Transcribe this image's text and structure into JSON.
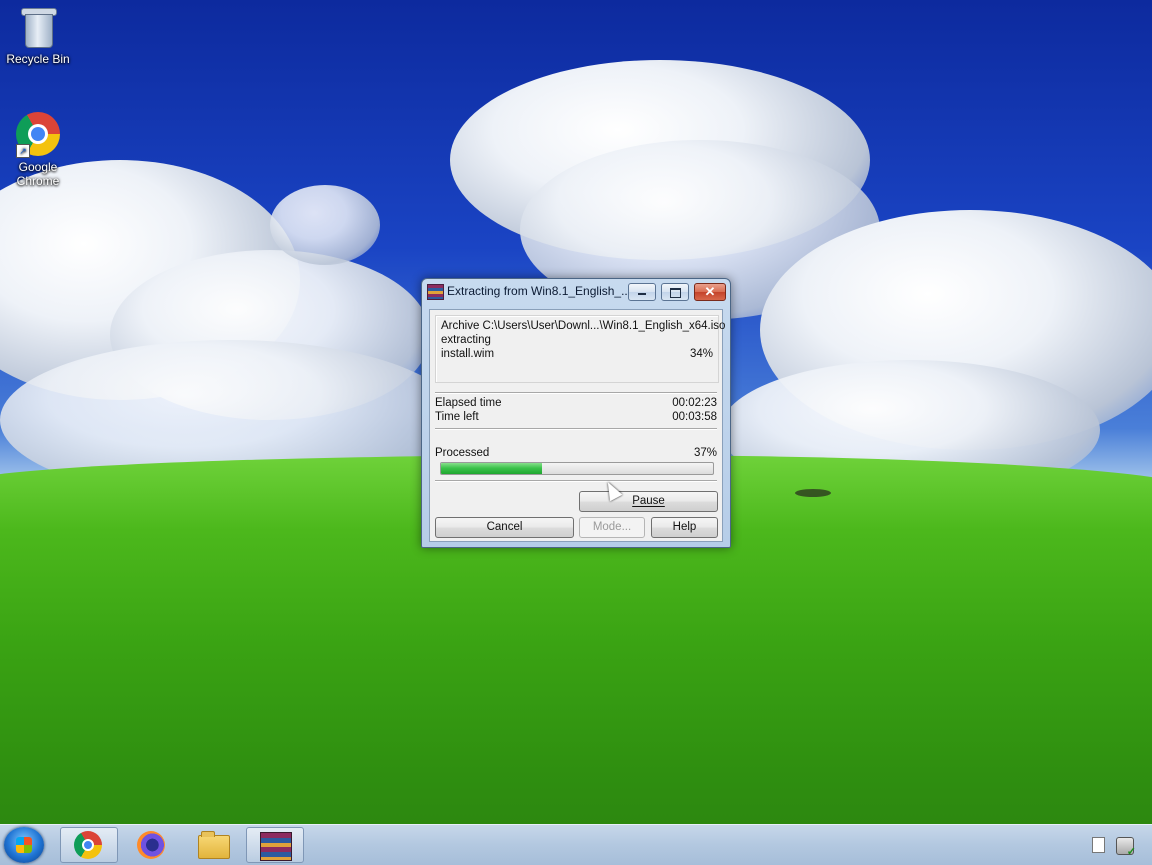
{
  "desktop": {
    "icons": [
      {
        "label": "Recycle Bin",
        "icon": "recycle-bin-icon"
      },
      {
        "label": "Google Chrome",
        "icon": "chrome-icon"
      }
    ]
  },
  "dialog": {
    "title": "Extracting from Win8.1_English_...",
    "archive_line": "Archive C:\\Users\\User\\Downl...\\Win8.1_English_x64.iso",
    "status": "extracting",
    "file_name": "install.wim",
    "file_percent": "34%",
    "elapsed_label": "Elapsed time",
    "elapsed_value": "00:02:23",
    "timeleft_label": "Time left",
    "timeleft_value": "00:03:58",
    "processed_label": "Processed",
    "processed_percent": "37%",
    "progress_fraction": 0.37,
    "buttons": {
      "pause": "Pause",
      "cancel": "Cancel",
      "mode": "Mode...",
      "help": "Help"
    },
    "window_controls": {
      "close": "✕"
    }
  },
  "taskbar": {
    "items": [
      {
        "name": "Google Chrome",
        "icon": "chrome-icon"
      },
      {
        "name": "Firefox",
        "icon": "firefox-icon"
      },
      {
        "name": "File Explorer",
        "icon": "folder-icon"
      },
      {
        "name": "WinRAR",
        "icon": "winrar-icon",
        "active": true
      }
    ],
    "tray_icons": [
      "document-icon",
      "network-icon"
    ]
  },
  "colors": {
    "progress": "#2fb83d",
    "sky": "#1a44c4",
    "grass": "#3aa313"
  }
}
